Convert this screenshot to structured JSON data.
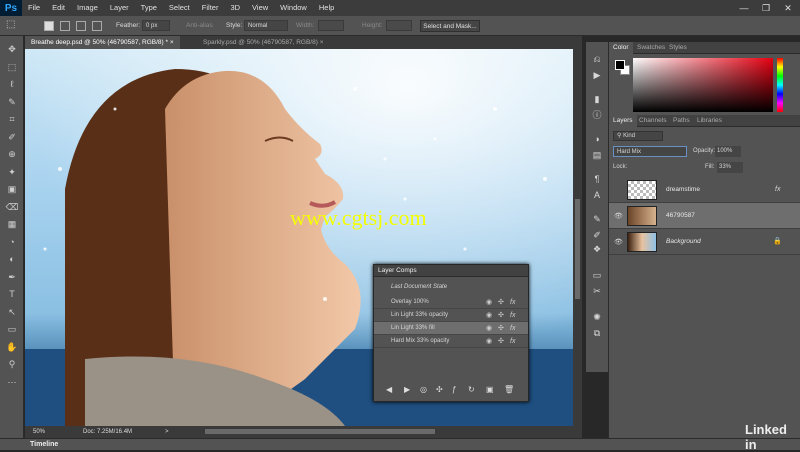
{
  "app": {
    "logo": "Ps"
  },
  "menus": [
    "File",
    "Edit",
    "Image",
    "Layer",
    "Type",
    "Select",
    "Filter",
    "3D",
    "View",
    "Window",
    "Help"
  ],
  "window_controls": [
    "—",
    "❐",
    "✕"
  ],
  "options": {
    "feather_label": "Feather:",
    "feather_value": "0 px",
    "anti_alias": "Anti-alias",
    "style_label": "Style:",
    "style_value": "Normal",
    "width_label": "Width:",
    "height_label": "Height:",
    "select_mask": "Select and Mask..."
  },
  "tabs": [
    {
      "label": "Breathe deep.psd @ 50% (46790587, RGB/8) *",
      "close": "×"
    },
    {
      "label": "Sparkly.psd @ 50% (46790587, RGB/8)",
      "close": "×"
    }
  ],
  "status": {
    "zoom": "50%",
    "doc": "Doc: 7.25M/16.4M",
    "arrow": ">"
  },
  "timeline": {
    "label": "Timeline"
  },
  "watermark": "www.cgtsj.com",
  "tools": [
    "✥",
    "⬚",
    "ℓ",
    "✎",
    "⌗",
    "✐",
    "⊕",
    "✦",
    "▣",
    "⌫",
    "▦",
    "◔",
    "◐",
    "✒",
    "T",
    "↖",
    "▭",
    "✋",
    "⚲",
    "⋯"
  ],
  "color_panel": {
    "tabs": [
      "Color",
      "Swatches",
      "Styles"
    ],
    "colors": {
      "foreground": "#000000",
      "background": "#ffffff"
    }
  },
  "layers_panel": {
    "tabs": [
      "Layers",
      "Channels",
      "Paths",
      "Libraries"
    ],
    "kind": "Kind",
    "blend_mode": "Hard Mix",
    "opacity_label": "Opacity:",
    "opacity_value": "100%",
    "lock_label": "Lock:",
    "fill_label": "Fill:",
    "fill_value": "33%",
    "layers": [
      {
        "name": "dreamstime",
        "fx": "fx",
        "visible": false
      },
      {
        "name": "46790587",
        "fx": "",
        "visible": true
      },
      {
        "name": "Background",
        "fx": "",
        "visible": true,
        "locked": true
      }
    ]
  },
  "layer_comps": {
    "title": "Layer Comps",
    "last_state": "Last Document State",
    "comps": [
      {
        "name": "Overlay 100%"
      },
      {
        "name": "Lin Light 33% opacity"
      },
      {
        "name": "Lin Light 33% fill",
        "selected": true
      },
      {
        "name": "Hard Mix 33% opacity"
      }
    ],
    "fx": "fx"
  },
  "branding": {
    "text": "Linked in"
  }
}
